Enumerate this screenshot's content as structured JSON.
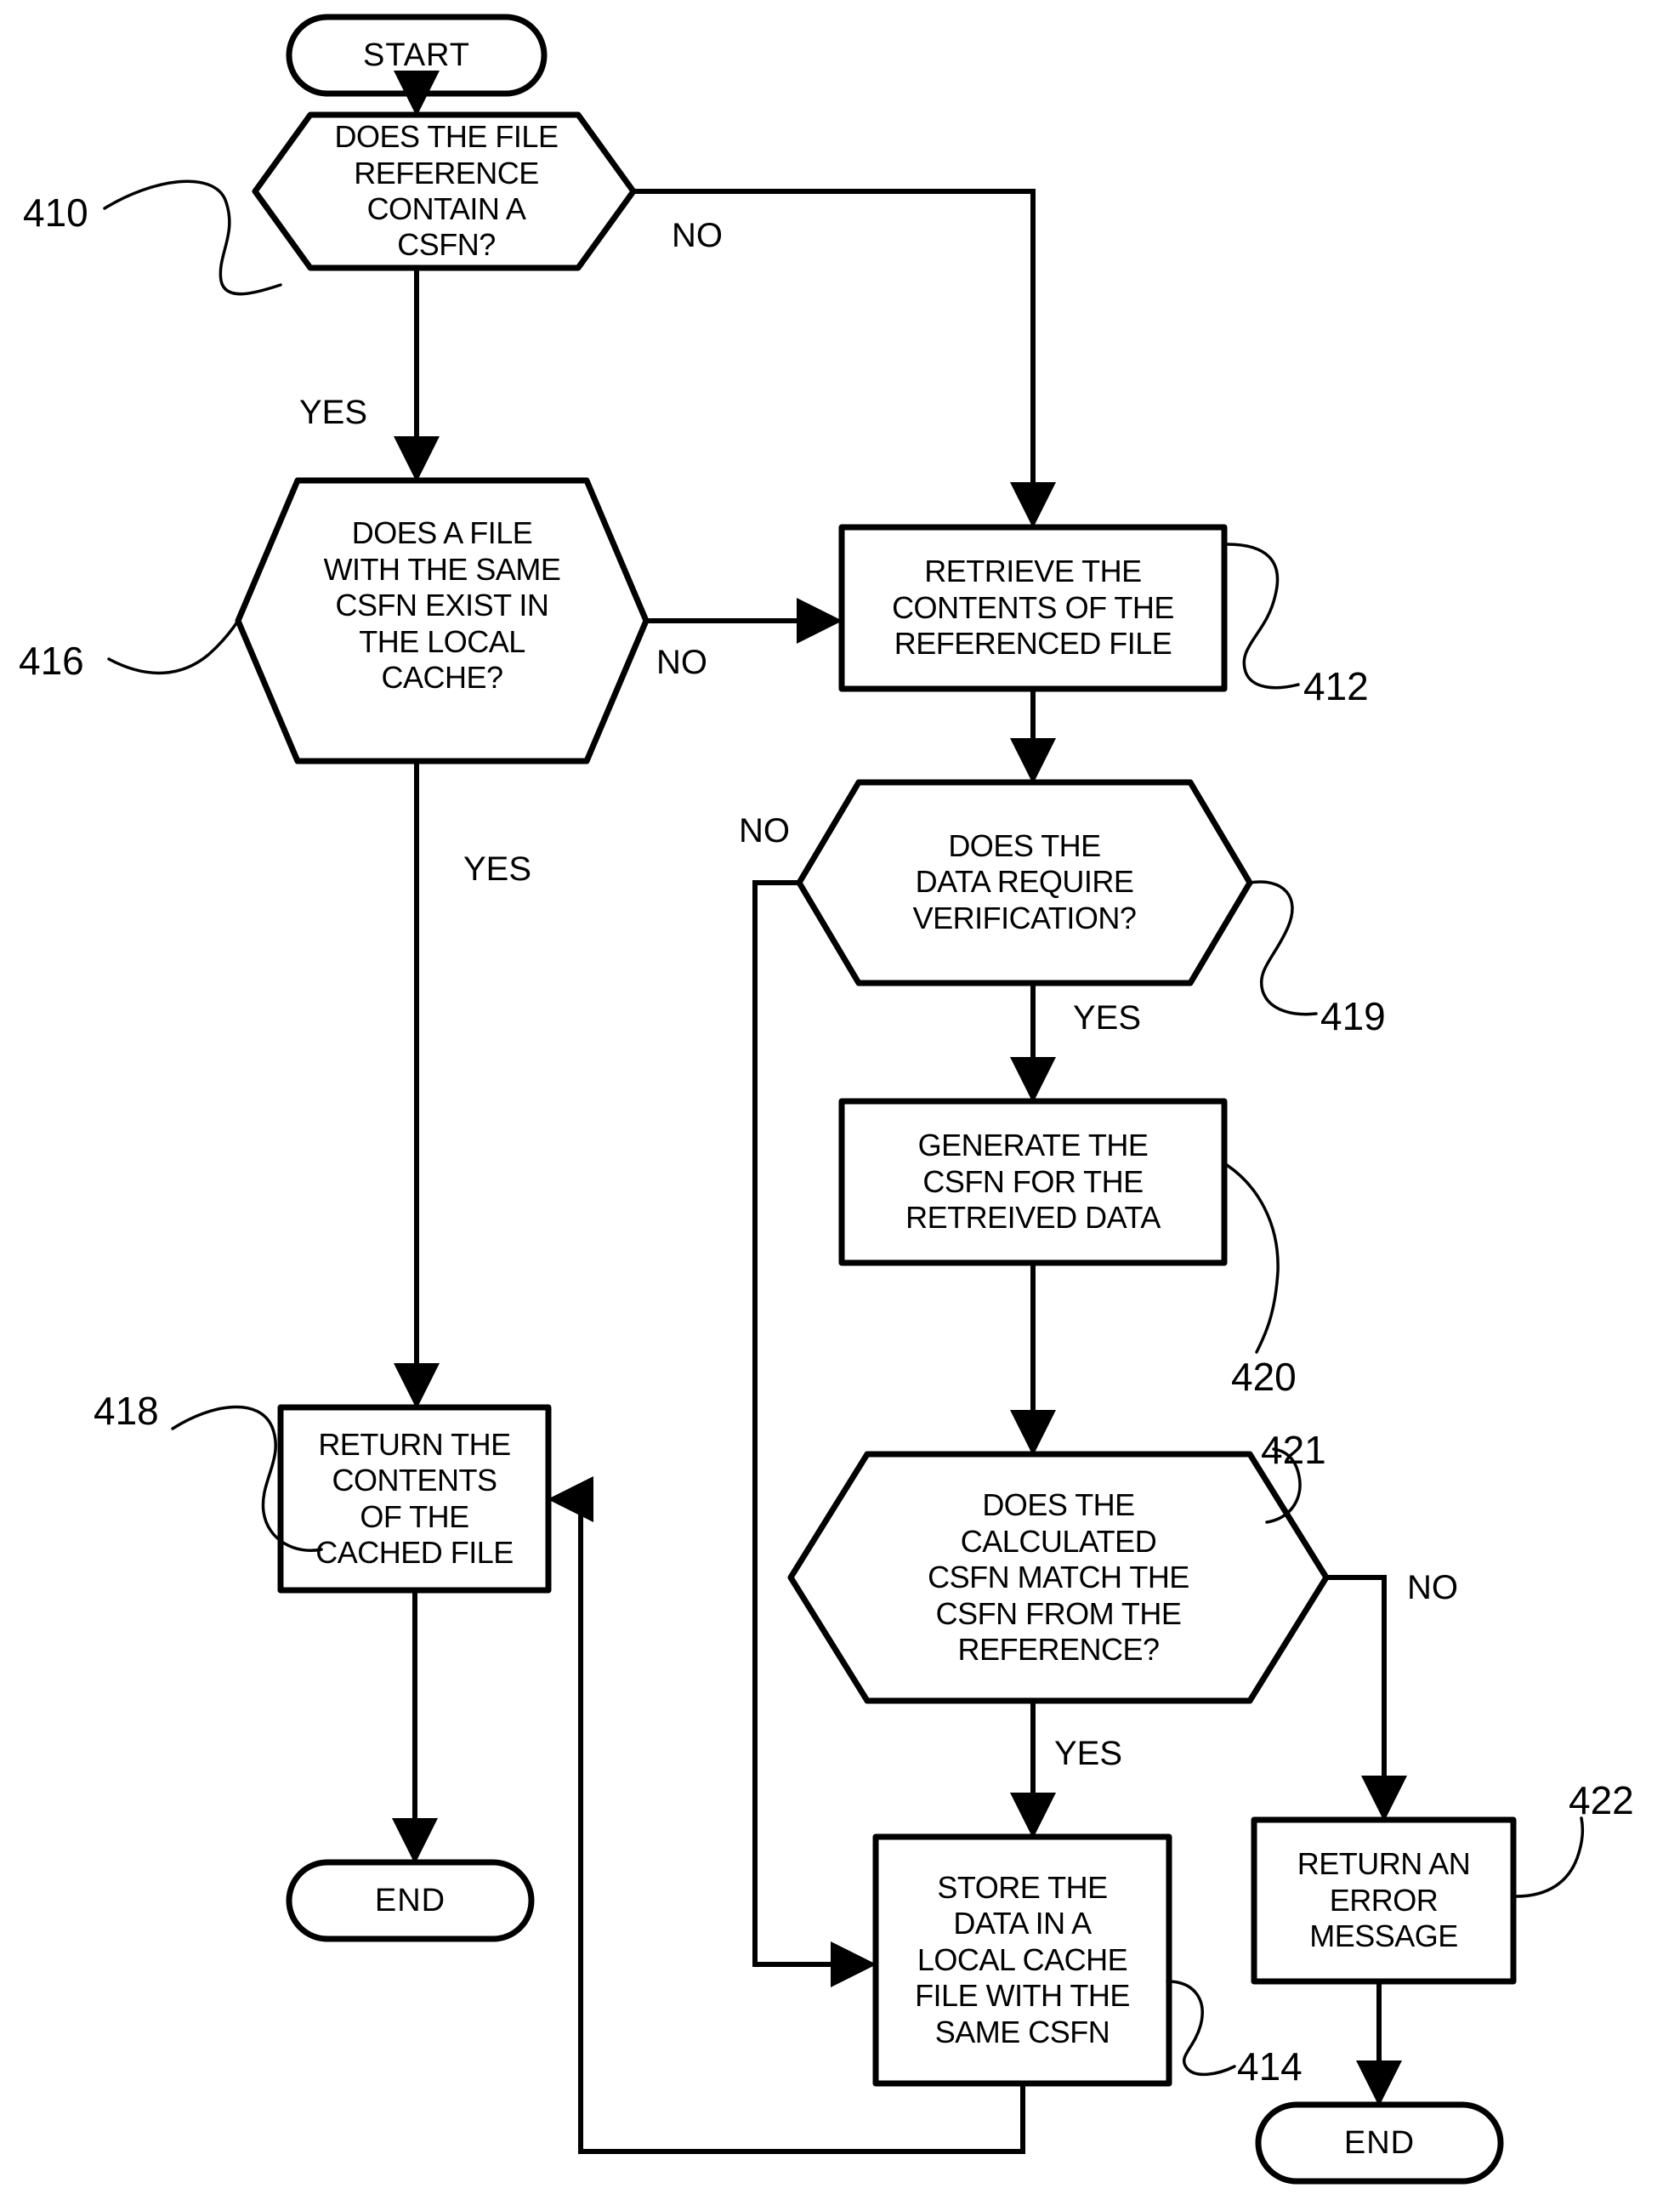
{
  "figure": {
    "kind": "flowchart",
    "nodes": [
      {
        "id": "start",
        "shape": "terminal",
        "lines": [
          "START"
        ]
      },
      {
        "id": "n410",
        "shape": "hexagon",
        "lines": [
          "DOES THE FILE",
          "REFERENCE",
          "CONTAIN A",
          "CSFN?"
        ]
      },
      {
        "id": "n416",
        "shape": "hexagon",
        "lines": [
          "DOES A FILE",
          "WITH THE SAME",
          "CSFN EXIST IN",
          "THE LOCAL",
          "CACHE?"
        ]
      },
      {
        "id": "n412",
        "shape": "process",
        "lines": [
          "RETRIEVE THE",
          "CONTENTS OF THE",
          "REFERENCED FILE"
        ]
      },
      {
        "id": "n419",
        "shape": "hexagon",
        "lines": [
          "DOES THE",
          "DATA REQUIRE",
          "VERIFICATION?"
        ]
      },
      {
        "id": "n420",
        "shape": "process",
        "lines": [
          "GENERATE THE",
          "CSFN FOR THE",
          "RETREIVED DATA"
        ]
      },
      {
        "id": "n421",
        "shape": "hexagon",
        "lines": [
          "DOES THE",
          "CALCULATED",
          "CSFN MATCH THE",
          "CSFN FROM THE",
          "REFERENCE?"
        ]
      },
      {
        "id": "n418",
        "shape": "process",
        "lines": [
          "RETURN THE",
          "CONTENTS",
          "OF THE",
          "CACHED FILE"
        ]
      },
      {
        "id": "n414",
        "shape": "process",
        "lines": [
          "STORE THE",
          "DATA IN A",
          "LOCAL CACHE",
          "FILE WITH THE",
          "SAME CSFN"
        ]
      },
      {
        "id": "n422",
        "shape": "process",
        "lines": [
          "RETURN AN",
          "ERROR",
          "MESSAGE"
        ]
      },
      {
        "id": "end_left",
        "shape": "terminal",
        "lines": [
          "END"
        ]
      },
      {
        "id": "end_right",
        "shape": "terminal",
        "lines": [
          "END"
        ]
      }
    ],
    "edge_labels": [
      {
        "id": "lbl_410_no",
        "text": "NO"
      },
      {
        "id": "lbl_410_yes",
        "text": "YES"
      },
      {
        "id": "lbl_416_no",
        "text": "NO"
      },
      {
        "id": "lbl_416_yes",
        "text": "YES"
      },
      {
        "id": "lbl_419_no",
        "text": "NO"
      },
      {
        "id": "lbl_419_yes",
        "text": "YES"
      },
      {
        "id": "lbl_421_no",
        "text": "NO"
      },
      {
        "id": "lbl_421_yes",
        "text": "YES"
      }
    ],
    "reference_numerals": [
      {
        "id": "ref410",
        "text": "410"
      },
      {
        "id": "ref416",
        "text": "416"
      },
      {
        "id": "ref412",
        "text": "412"
      },
      {
        "id": "ref419",
        "text": "419"
      },
      {
        "id": "ref420",
        "text": "420"
      },
      {
        "id": "ref421",
        "text": "421"
      },
      {
        "id": "ref418",
        "text": "418"
      },
      {
        "id": "ref414",
        "text": "414"
      },
      {
        "id": "ref422",
        "text": "422"
      }
    ],
    "colors": {
      "stroke": "#000000",
      "fill": "#ffffff",
      "text": "#000000"
    }
  }
}
